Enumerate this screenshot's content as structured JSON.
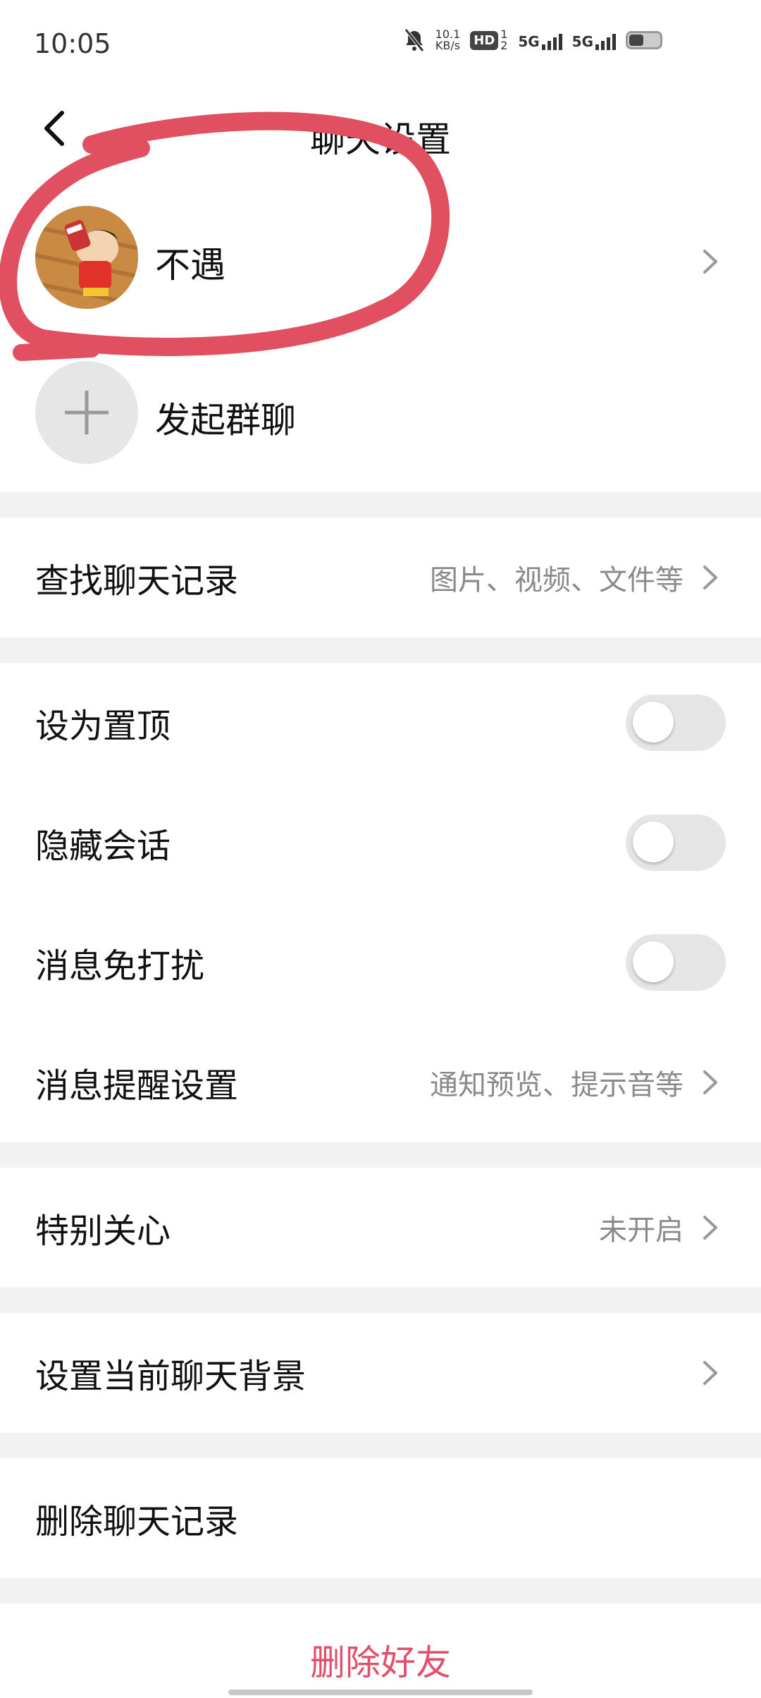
{
  "status_bar": {
    "time": "10:05",
    "network_speed_top": "10.1",
    "network_speed_unit": "KB/s",
    "hd_label": "HD",
    "hd_sub": "1 2",
    "sim1_label": "5G",
    "sim2_label": "5G",
    "icons": [
      "mute-bell-icon",
      "signal-icon",
      "battery-icon"
    ]
  },
  "header": {
    "title": "聊天设置",
    "back_icon": "back-chevron-icon"
  },
  "contact": {
    "name": "不遇",
    "add_group_label": "发起群聊"
  },
  "search_history": {
    "label": "查找聊天记录",
    "value": "图片、视频、文件等"
  },
  "toggles": [
    {
      "label": "设为置顶",
      "on": false
    },
    {
      "label": "隐藏会话",
      "on": false
    },
    {
      "label": "消息免打扰",
      "on": false
    }
  ],
  "notification_settings": {
    "label": "消息提醒设置",
    "value": "通知预览、提示音等"
  },
  "special_care": {
    "label": "特别关心",
    "value": "未开启"
  },
  "chat_background": {
    "label": "设置当前聊天背景"
  },
  "delete_history": {
    "label": "删除聊天记录"
  },
  "delete_friend": {
    "label": "删除好友"
  },
  "colors": {
    "danger": "#e0506a",
    "annotation": "#e05060",
    "toggle_off": "#e5e5e5",
    "secondary_text": "#8a8a8a"
  }
}
